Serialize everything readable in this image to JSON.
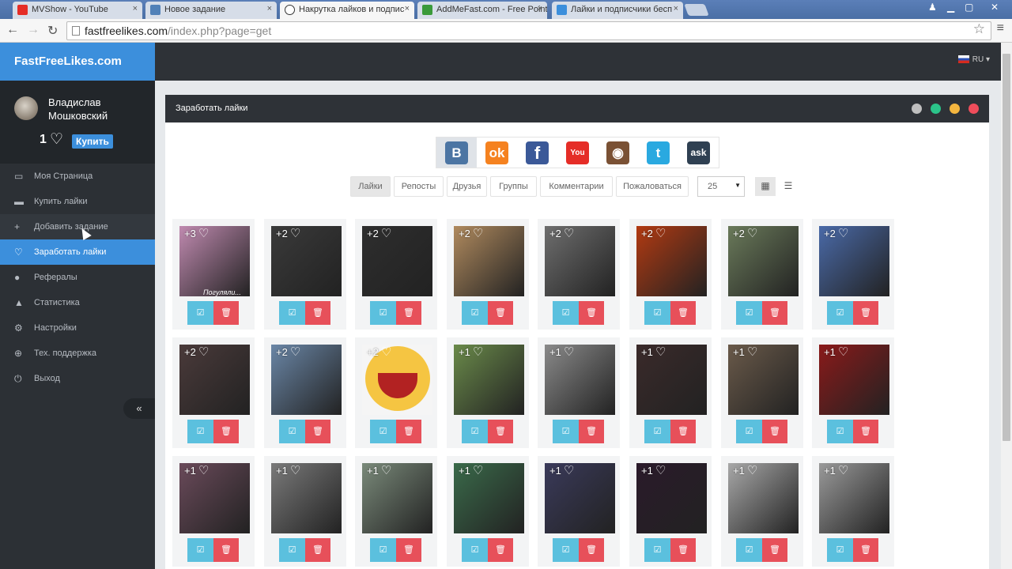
{
  "browser": {
    "tabs": [
      {
        "label": "MVShow - YouTube",
        "color": "#e52d27"
      },
      {
        "label": "Новое задание",
        "color": "#5181b8"
      },
      {
        "label": "Накрутка лайков и подпис",
        "color": "#ffffff"
      },
      {
        "label": "AddMeFast.com - Free Point",
        "color": "#3a9a3a"
      },
      {
        "label": "Лайки и подписчики бесп",
        "color": "#3c8fdc"
      }
    ],
    "url_host": "fastfreelikes.com",
    "url_path": "/index.php?page=get",
    "nav": {
      "back": "←",
      "forward": "→",
      "reload": "↻"
    }
  },
  "sidebar": {
    "brand": "FastFreeLikes.com",
    "user": {
      "name": "Владислав Мошковский",
      "likes": "1",
      "buy_label": "Купить"
    },
    "items": [
      {
        "label": "Моя Страница",
        "icon": "laptop-icon",
        "glyph": "▭"
      },
      {
        "label": "Купить лайки",
        "icon": "card-icon",
        "glyph": "▬"
      },
      {
        "label": "Добавить задание",
        "icon": "plus-icon",
        "glyph": "+"
      },
      {
        "label": "Заработать лайки",
        "icon": "heart-icon",
        "glyph": "♡"
      },
      {
        "label": "Рефералы",
        "icon": "users-icon",
        "glyph": "●"
      },
      {
        "label": "Статистика",
        "icon": "chart-icon",
        "glyph": "▲"
      },
      {
        "label": "Настройки",
        "icon": "gears-icon",
        "glyph": "⚙"
      },
      {
        "label": "Тех. поддержка",
        "icon": "globe-icon",
        "glyph": "⊕"
      },
      {
        "label": "Выход",
        "icon": "power-icon",
        "glyph": "⏻"
      }
    ],
    "collapse": "«"
  },
  "topbar": {
    "lang": "RU"
  },
  "panel": {
    "title": "Заработать лайки",
    "controls": [
      {
        "name": "settings",
        "color": "#bfbfbf"
      },
      {
        "name": "refresh",
        "color": "#2bc48a"
      },
      {
        "name": "minimize",
        "color": "#f4b63f"
      },
      {
        "name": "close",
        "color": "#ef4d5b"
      }
    ],
    "networks": [
      {
        "name": "vk",
        "text": "B",
        "color": "#4c75a3"
      },
      {
        "name": "odnoklassniki",
        "text": "ok",
        "color": "#f58220"
      },
      {
        "name": "facebook",
        "text": "f",
        "color": "#3b5998"
      },
      {
        "name": "youtube",
        "text": "You",
        "color": "#e52d27"
      },
      {
        "name": "instagram",
        "text": "◉",
        "color": "#7a5134"
      },
      {
        "name": "twitter",
        "text": "t",
        "color": "#2aa9e0"
      },
      {
        "name": "askfm",
        "text": "ask",
        "color": "#2f4052"
      }
    ],
    "filters": [
      "Лайки",
      "Репосты",
      "Друзья",
      "Группы",
      "Комментарии",
      "Пожаловаться"
    ],
    "per_page": "25"
  },
  "cards": [
    [
      "+3",
      "+2",
      "+2",
      "+2",
      "+2",
      "+2",
      "+2",
      "+2"
    ],
    [
      "+2",
      "+2",
      "+2",
      "+1",
      "+1",
      "+1",
      "+1",
      "+1"
    ],
    [
      "+1",
      "+1",
      "+1",
      "+1",
      "+1",
      "+1",
      "+1",
      "+1"
    ]
  ],
  "card_thumbs": [
    [
      "#c08ab0",
      "#3a3a3a",
      "#2e2e2e",
      "#b08a5e",
      "#6e6e6e",
      "#b23a12",
      "#6a7a5a",
      "#4a6aa8"
    ],
    [
      "#4a3a3a",
      "#6a86a6",
      "#f5c542",
      "#6a8a4a",
      "#8a8a8a",
      "#3a2a2a",
      "#6a5a4a",
      "#8a1a1a"
    ],
    [
      "#6a4a5a",
      "#7a7a7a",
      "#7a8a7a",
      "#3a6a4a",
      "#3a3a5a",
      "#2a1a2a",
      "#a8a8a8",
      "#9a9a9a"
    ]
  ],
  "thumb_caption": "Погуляли..."
}
